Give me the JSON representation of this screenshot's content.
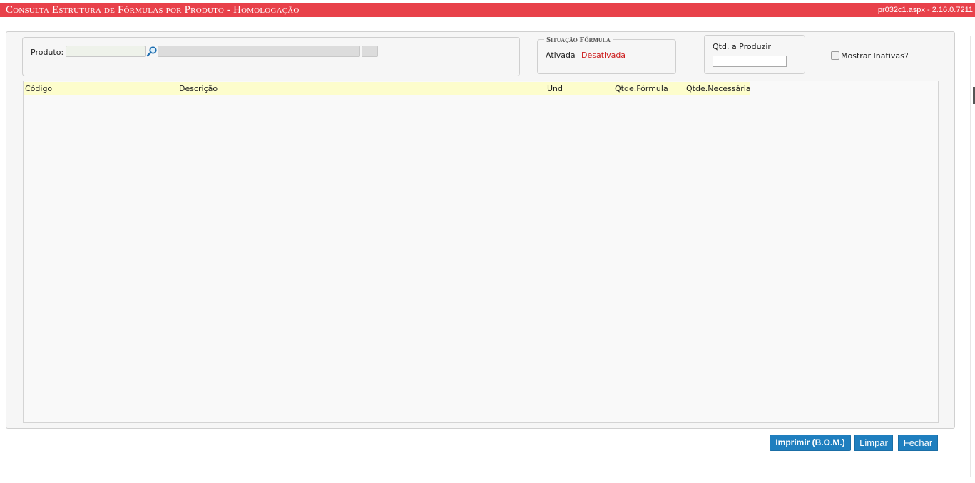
{
  "titlebar": {
    "title": "Consulta Estrutura de Fórmulas por Produto  - Homologação",
    "version": "pr032c1.aspx - 2.16.0.7211"
  },
  "produto": {
    "label": "Produto:",
    "code_value": "",
    "description_value": ""
  },
  "situacao": {
    "legend": "Situação Fórmula",
    "option_ativada": "Ativada",
    "option_desativada": "Desativada",
    "desativada_color": "#cc1a1a"
  },
  "qtd": {
    "label": "Qtd. a Produzir",
    "value": ""
  },
  "mostrar_inativas": {
    "label": "Mostrar Inativas?",
    "checked": false
  },
  "grid": {
    "columns": [
      "Código",
      "Descrição",
      "Und",
      "Qtde.Fórmula",
      "Qtde.Necessária"
    ],
    "rows": []
  },
  "buttons": {
    "imprimir": "Imprimir (B.O.M.)",
    "limpar": "Limpar",
    "fechar": "Fechar"
  },
  "colors": {
    "titlebar": "#e8414a",
    "button": "#1f7fbf",
    "grid_header": "#fdfdcc"
  }
}
